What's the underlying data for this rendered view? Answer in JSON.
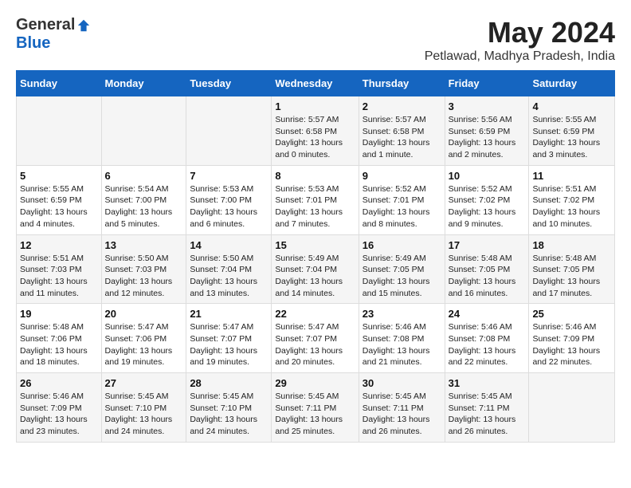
{
  "logo": {
    "general": "General",
    "blue": "Blue"
  },
  "title": "May 2024",
  "location": "Petlawad, Madhya Pradesh, India",
  "days_of_week": [
    "Sunday",
    "Monday",
    "Tuesday",
    "Wednesday",
    "Thursday",
    "Friday",
    "Saturday"
  ],
  "weeks": [
    [
      {
        "day": "",
        "info": ""
      },
      {
        "day": "",
        "info": ""
      },
      {
        "day": "",
        "info": ""
      },
      {
        "day": "1",
        "info": "Sunrise: 5:57 AM\nSunset: 6:58 PM\nDaylight: 13 hours\nand 0 minutes."
      },
      {
        "day": "2",
        "info": "Sunrise: 5:57 AM\nSunset: 6:58 PM\nDaylight: 13 hours\nand 1 minute."
      },
      {
        "day": "3",
        "info": "Sunrise: 5:56 AM\nSunset: 6:59 PM\nDaylight: 13 hours\nand 2 minutes."
      },
      {
        "day": "4",
        "info": "Sunrise: 5:55 AM\nSunset: 6:59 PM\nDaylight: 13 hours\nand 3 minutes."
      }
    ],
    [
      {
        "day": "5",
        "info": "Sunrise: 5:55 AM\nSunset: 6:59 PM\nDaylight: 13 hours\nand 4 minutes."
      },
      {
        "day": "6",
        "info": "Sunrise: 5:54 AM\nSunset: 7:00 PM\nDaylight: 13 hours\nand 5 minutes."
      },
      {
        "day": "7",
        "info": "Sunrise: 5:53 AM\nSunset: 7:00 PM\nDaylight: 13 hours\nand 6 minutes."
      },
      {
        "day": "8",
        "info": "Sunrise: 5:53 AM\nSunset: 7:01 PM\nDaylight: 13 hours\nand 7 minutes."
      },
      {
        "day": "9",
        "info": "Sunrise: 5:52 AM\nSunset: 7:01 PM\nDaylight: 13 hours\nand 8 minutes."
      },
      {
        "day": "10",
        "info": "Sunrise: 5:52 AM\nSunset: 7:02 PM\nDaylight: 13 hours\nand 9 minutes."
      },
      {
        "day": "11",
        "info": "Sunrise: 5:51 AM\nSunset: 7:02 PM\nDaylight: 13 hours\nand 10 minutes."
      }
    ],
    [
      {
        "day": "12",
        "info": "Sunrise: 5:51 AM\nSunset: 7:03 PM\nDaylight: 13 hours\nand 11 minutes."
      },
      {
        "day": "13",
        "info": "Sunrise: 5:50 AM\nSunset: 7:03 PM\nDaylight: 13 hours\nand 12 minutes."
      },
      {
        "day": "14",
        "info": "Sunrise: 5:50 AM\nSunset: 7:04 PM\nDaylight: 13 hours\nand 13 minutes."
      },
      {
        "day": "15",
        "info": "Sunrise: 5:49 AM\nSunset: 7:04 PM\nDaylight: 13 hours\nand 14 minutes."
      },
      {
        "day": "16",
        "info": "Sunrise: 5:49 AM\nSunset: 7:05 PM\nDaylight: 13 hours\nand 15 minutes."
      },
      {
        "day": "17",
        "info": "Sunrise: 5:48 AM\nSunset: 7:05 PM\nDaylight: 13 hours\nand 16 minutes."
      },
      {
        "day": "18",
        "info": "Sunrise: 5:48 AM\nSunset: 7:05 PM\nDaylight: 13 hours\nand 17 minutes."
      }
    ],
    [
      {
        "day": "19",
        "info": "Sunrise: 5:48 AM\nSunset: 7:06 PM\nDaylight: 13 hours\nand 18 minutes."
      },
      {
        "day": "20",
        "info": "Sunrise: 5:47 AM\nSunset: 7:06 PM\nDaylight: 13 hours\nand 19 minutes."
      },
      {
        "day": "21",
        "info": "Sunrise: 5:47 AM\nSunset: 7:07 PM\nDaylight: 13 hours\nand 19 minutes."
      },
      {
        "day": "22",
        "info": "Sunrise: 5:47 AM\nSunset: 7:07 PM\nDaylight: 13 hours\nand 20 minutes."
      },
      {
        "day": "23",
        "info": "Sunrise: 5:46 AM\nSunset: 7:08 PM\nDaylight: 13 hours\nand 21 minutes."
      },
      {
        "day": "24",
        "info": "Sunrise: 5:46 AM\nSunset: 7:08 PM\nDaylight: 13 hours\nand 22 minutes."
      },
      {
        "day": "25",
        "info": "Sunrise: 5:46 AM\nSunset: 7:09 PM\nDaylight: 13 hours\nand 22 minutes."
      }
    ],
    [
      {
        "day": "26",
        "info": "Sunrise: 5:46 AM\nSunset: 7:09 PM\nDaylight: 13 hours\nand 23 minutes."
      },
      {
        "day": "27",
        "info": "Sunrise: 5:45 AM\nSunset: 7:10 PM\nDaylight: 13 hours\nand 24 minutes."
      },
      {
        "day": "28",
        "info": "Sunrise: 5:45 AM\nSunset: 7:10 PM\nDaylight: 13 hours\nand 24 minutes."
      },
      {
        "day": "29",
        "info": "Sunrise: 5:45 AM\nSunset: 7:11 PM\nDaylight: 13 hours\nand 25 minutes."
      },
      {
        "day": "30",
        "info": "Sunrise: 5:45 AM\nSunset: 7:11 PM\nDaylight: 13 hours\nand 26 minutes."
      },
      {
        "day": "31",
        "info": "Sunrise: 5:45 AM\nSunset: 7:11 PM\nDaylight: 13 hours\nand 26 minutes."
      },
      {
        "day": "",
        "info": ""
      }
    ]
  ]
}
